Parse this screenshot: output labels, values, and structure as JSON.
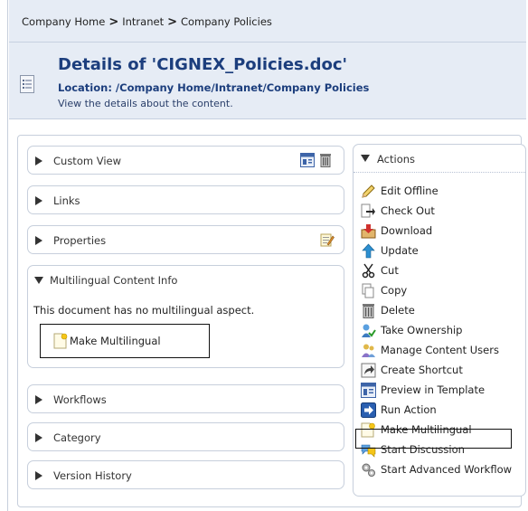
{
  "breadcrumb": {
    "items": [
      "Company Home",
      "Intranet",
      "Company Policies"
    ],
    "separator": ">"
  },
  "header": {
    "title": "Details of 'CIGNEX_Policies.doc'",
    "location": "Location: /Company Home/Intranet/Company Policies",
    "subtitle": "View the details about the content."
  },
  "panels": {
    "custom_view": "Custom View",
    "links": "Links",
    "properties": "Properties",
    "multilingual": {
      "label": "Multilingual Content Info",
      "message": "This document has no multilingual aspect.",
      "button": "Make Multilingual"
    },
    "workflows": "Workflows",
    "category": "Category",
    "version_history": "Version History"
  },
  "actions": {
    "title": "Actions",
    "items": [
      {
        "label": "Edit Offline",
        "icon": "pencil-icon"
      },
      {
        "label": "Check Out",
        "icon": "check-out-icon"
      },
      {
        "label": "Download",
        "icon": "download-icon"
      },
      {
        "label": "Update",
        "icon": "update-icon"
      },
      {
        "label": "Cut",
        "icon": "scissors-icon"
      },
      {
        "label": "Copy",
        "icon": "copy-icon"
      },
      {
        "label": "Delete",
        "icon": "trash-icon"
      },
      {
        "label": "Take Ownership",
        "icon": "take-ownership-icon"
      },
      {
        "label": "Manage Content Users",
        "icon": "users-icon"
      },
      {
        "label": "Create Shortcut",
        "icon": "shortcut-icon"
      },
      {
        "label": "Preview in Template",
        "icon": "template-icon"
      },
      {
        "label": "Run Action",
        "icon": "run-action-icon"
      },
      {
        "label": "Make Multilingual",
        "icon": "multilingual-icon"
      },
      {
        "label": "Start Discussion",
        "icon": "discussion-icon"
      },
      {
        "label": "Start Advanced Workflow",
        "icon": "workflow-icon"
      }
    ]
  },
  "colors": {
    "header_bg": "#e6ecf5",
    "title_blue": "#1c3e7d",
    "border": "#c7cfdc"
  }
}
